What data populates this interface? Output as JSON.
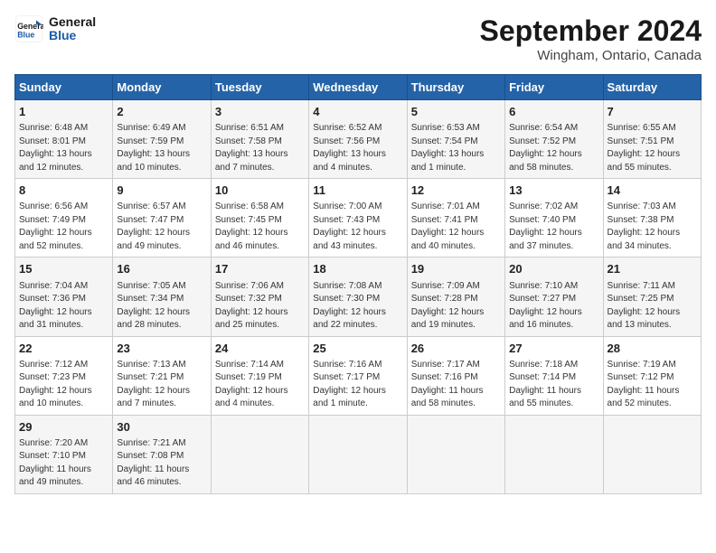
{
  "logo": {
    "line1": "General",
    "line2": "Blue"
  },
  "title": "September 2024",
  "location": "Wingham, Ontario, Canada",
  "days_header": [
    "Sunday",
    "Monday",
    "Tuesday",
    "Wednesday",
    "Thursday",
    "Friday",
    "Saturday"
  ],
  "weeks": [
    [
      {
        "day": "1",
        "info": "Sunrise: 6:48 AM\nSunset: 8:01 PM\nDaylight: 13 hours\nand 12 minutes."
      },
      {
        "day": "2",
        "info": "Sunrise: 6:49 AM\nSunset: 7:59 PM\nDaylight: 13 hours\nand 10 minutes."
      },
      {
        "day": "3",
        "info": "Sunrise: 6:51 AM\nSunset: 7:58 PM\nDaylight: 13 hours\nand 7 minutes."
      },
      {
        "day": "4",
        "info": "Sunrise: 6:52 AM\nSunset: 7:56 PM\nDaylight: 13 hours\nand 4 minutes."
      },
      {
        "day": "5",
        "info": "Sunrise: 6:53 AM\nSunset: 7:54 PM\nDaylight: 13 hours\nand 1 minute."
      },
      {
        "day": "6",
        "info": "Sunrise: 6:54 AM\nSunset: 7:52 PM\nDaylight: 12 hours\nand 58 minutes."
      },
      {
        "day": "7",
        "info": "Sunrise: 6:55 AM\nSunset: 7:51 PM\nDaylight: 12 hours\nand 55 minutes."
      }
    ],
    [
      {
        "day": "8",
        "info": "Sunrise: 6:56 AM\nSunset: 7:49 PM\nDaylight: 12 hours\nand 52 minutes."
      },
      {
        "day": "9",
        "info": "Sunrise: 6:57 AM\nSunset: 7:47 PM\nDaylight: 12 hours\nand 49 minutes."
      },
      {
        "day": "10",
        "info": "Sunrise: 6:58 AM\nSunset: 7:45 PM\nDaylight: 12 hours\nand 46 minutes."
      },
      {
        "day": "11",
        "info": "Sunrise: 7:00 AM\nSunset: 7:43 PM\nDaylight: 12 hours\nand 43 minutes."
      },
      {
        "day": "12",
        "info": "Sunrise: 7:01 AM\nSunset: 7:41 PM\nDaylight: 12 hours\nand 40 minutes."
      },
      {
        "day": "13",
        "info": "Sunrise: 7:02 AM\nSunset: 7:40 PM\nDaylight: 12 hours\nand 37 minutes."
      },
      {
        "day": "14",
        "info": "Sunrise: 7:03 AM\nSunset: 7:38 PM\nDaylight: 12 hours\nand 34 minutes."
      }
    ],
    [
      {
        "day": "15",
        "info": "Sunrise: 7:04 AM\nSunset: 7:36 PM\nDaylight: 12 hours\nand 31 minutes."
      },
      {
        "day": "16",
        "info": "Sunrise: 7:05 AM\nSunset: 7:34 PM\nDaylight: 12 hours\nand 28 minutes."
      },
      {
        "day": "17",
        "info": "Sunrise: 7:06 AM\nSunset: 7:32 PM\nDaylight: 12 hours\nand 25 minutes."
      },
      {
        "day": "18",
        "info": "Sunrise: 7:08 AM\nSunset: 7:30 PM\nDaylight: 12 hours\nand 22 minutes."
      },
      {
        "day": "19",
        "info": "Sunrise: 7:09 AM\nSunset: 7:28 PM\nDaylight: 12 hours\nand 19 minutes."
      },
      {
        "day": "20",
        "info": "Sunrise: 7:10 AM\nSunset: 7:27 PM\nDaylight: 12 hours\nand 16 minutes."
      },
      {
        "day": "21",
        "info": "Sunrise: 7:11 AM\nSunset: 7:25 PM\nDaylight: 12 hours\nand 13 minutes."
      }
    ],
    [
      {
        "day": "22",
        "info": "Sunrise: 7:12 AM\nSunset: 7:23 PM\nDaylight: 12 hours\nand 10 minutes."
      },
      {
        "day": "23",
        "info": "Sunrise: 7:13 AM\nSunset: 7:21 PM\nDaylight: 12 hours\nand 7 minutes."
      },
      {
        "day": "24",
        "info": "Sunrise: 7:14 AM\nSunset: 7:19 PM\nDaylight: 12 hours\nand 4 minutes."
      },
      {
        "day": "25",
        "info": "Sunrise: 7:16 AM\nSunset: 7:17 PM\nDaylight: 12 hours\nand 1 minute."
      },
      {
        "day": "26",
        "info": "Sunrise: 7:17 AM\nSunset: 7:16 PM\nDaylight: 11 hours\nand 58 minutes."
      },
      {
        "day": "27",
        "info": "Sunrise: 7:18 AM\nSunset: 7:14 PM\nDaylight: 11 hours\nand 55 minutes."
      },
      {
        "day": "28",
        "info": "Sunrise: 7:19 AM\nSunset: 7:12 PM\nDaylight: 11 hours\nand 52 minutes."
      }
    ],
    [
      {
        "day": "29",
        "info": "Sunrise: 7:20 AM\nSunset: 7:10 PM\nDaylight: 11 hours\nand 49 minutes."
      },
      {
        "day": "30",
        "info": "Sunrise: 7:21 AM\nSunset: 7:08 PM\nDaylight: 11 hours\nand 46 minutes."
      },
      {
        "day": "",
        "info": ""
      },
      {
        "day": "",
        "info": ""
      },
      {
        "day": "",
        "info": ""
      },
      {
        "day": "",
        "info": ""
      },
      {
        "day": "",
        "info": ""
      }
    ]
  ]
}
